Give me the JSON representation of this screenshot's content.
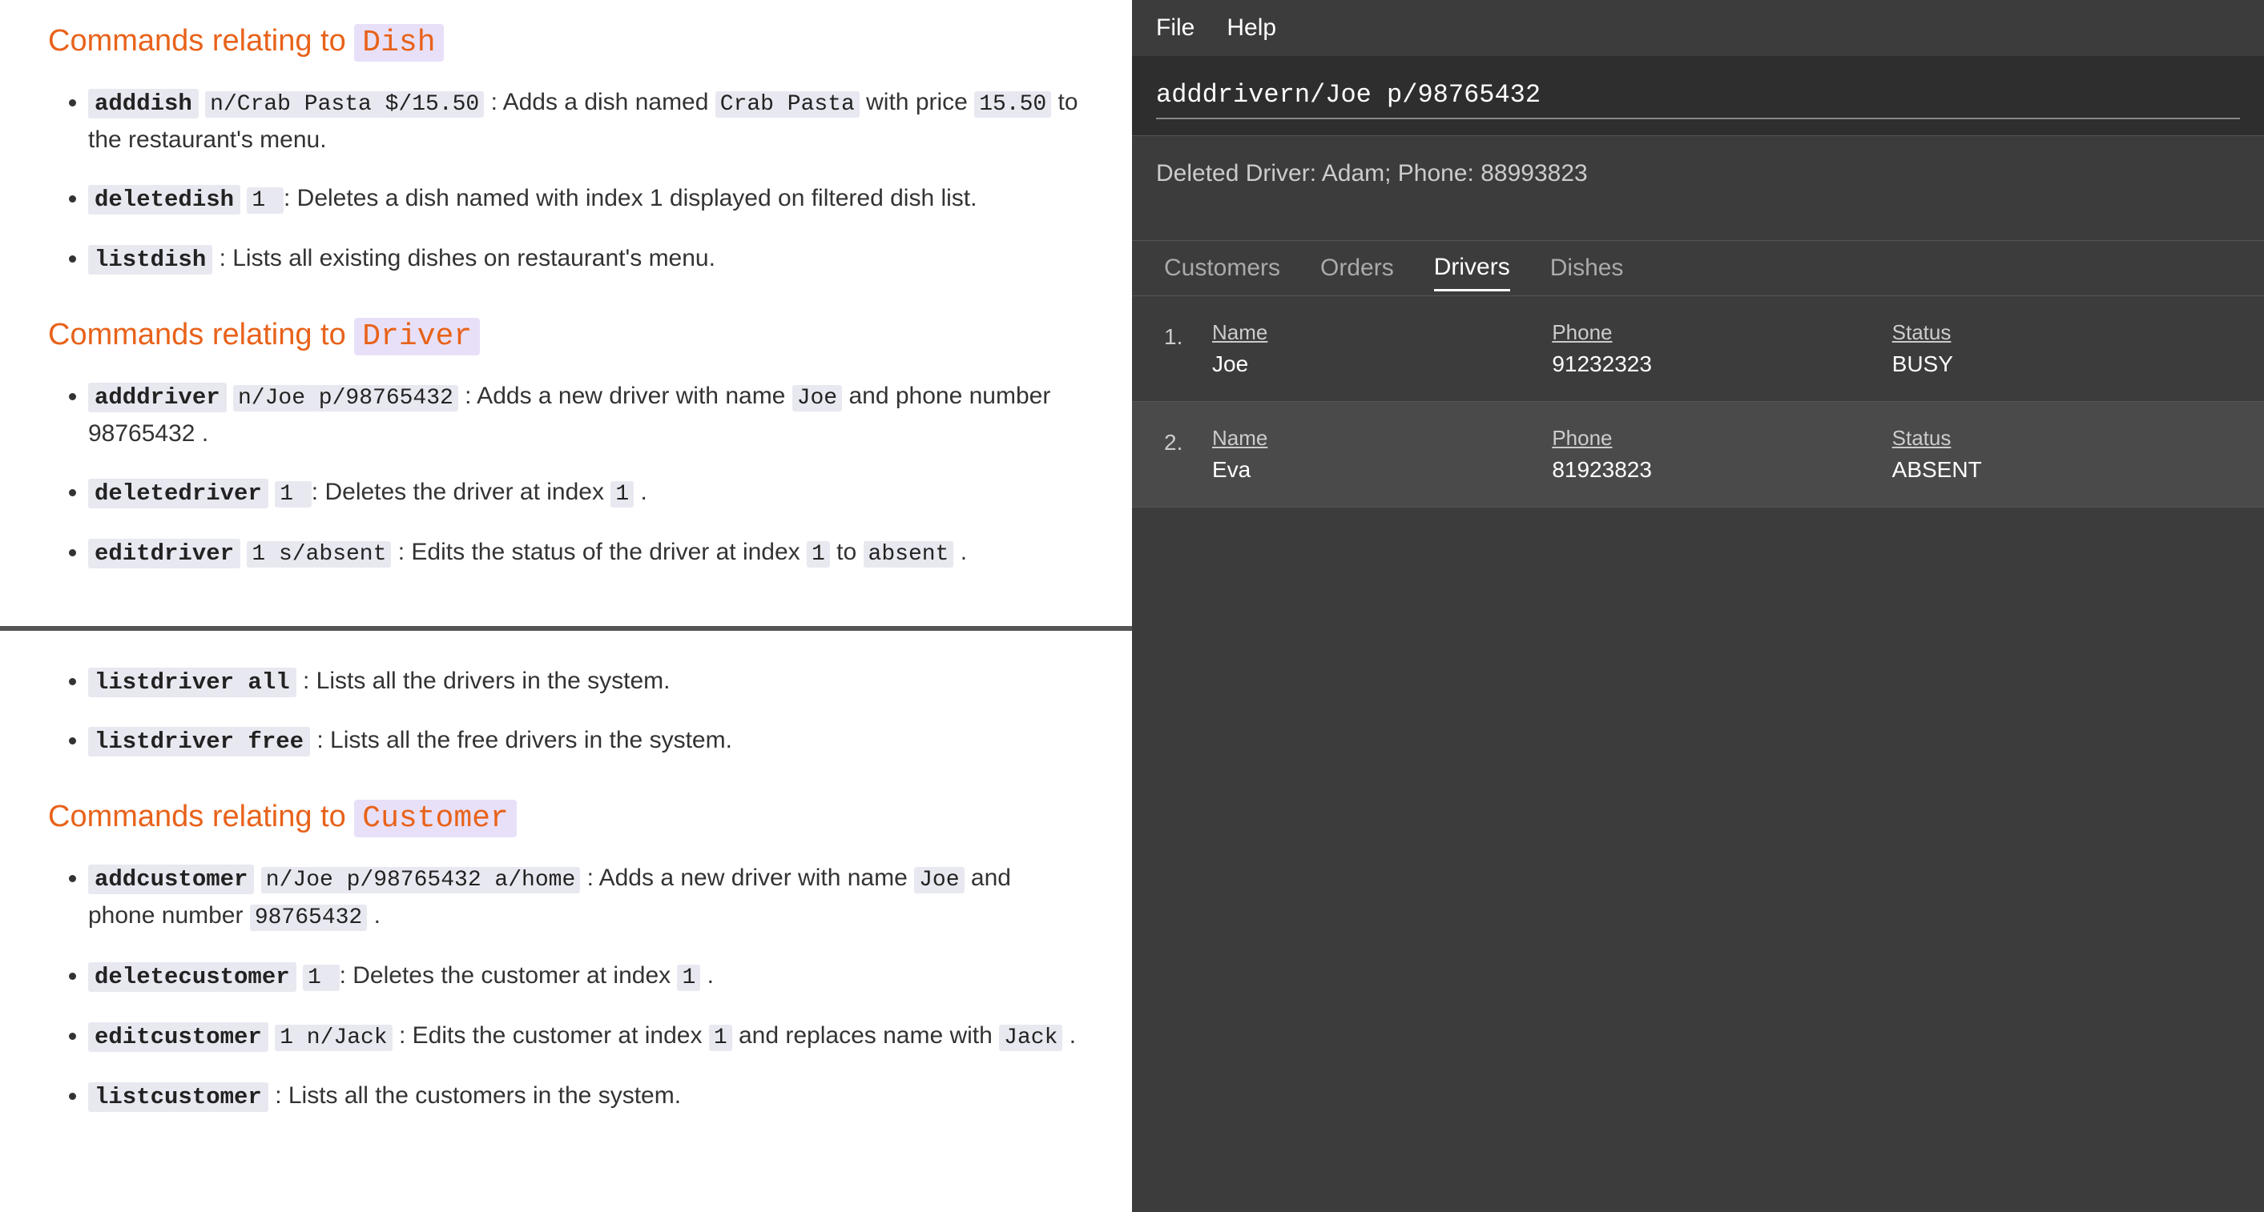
{
  "left": {
    "top_section": {
      "heading_prefix": "Commands relating to ",
      "heading_keyword": "Dish",
      "items": [
        {
          "cmd": "adddish",
          "cmd_args": "n/Crab Pasta $/15.50",
          "desc_before": ": Adds a dish named ",
          "inline1": "Crab Pasta",
          "desc_middle": " with price ",
          "inline2": "15.50",
          "desc_after": " to the restaurant's menu."
        },
        {
          "cmd": "deletedish",
          "cmd_args": null,
          "inline1": "1",
          "desc_after": ": Deletes a dish named with index 1 displayed on filtered dish list."
        },
        {
          "cmd": "listdish",
          "desc_after": ": Lists all existing dishes on restaurant's menu."
        }
      ]
    },
    "driver_section": {
      "heading_prefix": "Commands relating to ",
      "heading_keyword": "Driver",
      "items": [
        {
          "cmd": "adddriver",
          "cmd_args": "n/Joe p/98765432",
          "desc_before": ": Adds a new driver with name ",
          "inline1": "Joe",
          "desc_middle": " and phone number ",
          "inline2": "98765432",
          "desc_after": "."
        },
        {
          "cmd": "deletedriver",
          "inline1": "1",
          "desc_after": ": Deletes the driver at index ",
          "inline2": "1",
          "desc_end": "."
        },
        {
          "cmd": "editdriver",
          "cmd_args": "1 s/absent",
          "desc_before": ": Edits the status of the driver at index ",
          "inline1": "1",
          "desc_middle": " to ",
          "inline2": "absent",
          "desc_after": "."
        }
      ]
    },
    "bottom_section": {
      "driver_continued": [
        {
          "cmd": "listdriver all",
          "desc_after": ": Lists all the drivers in the system."
        },
        {
          "cmd": "listdriver free",
          "desc_after": ": Lists all the free drivers in the system."
        }
      ],
      "customer_section": {
        "heading_prefix": "Commands relating to ",
        "heading_keyword": "Customer",
        "items": [
          {
            "cmd": "addcustomer",
            "cmd_args": "n/Joe p/98765432 a/home",
            "desc_before": ": Adds a new driver with name ",
            "inline1": "Joe",
            "desc_middle": " and phone number ",
            "inline2": "98765432",
            "desc_after": "."
          },
          {
            "cmd": "deletecustomer",
            "inline1": "1",
            "desc_before": ": Deletes the customer at index ",
            "inline2": "1",
            "desc_after": "."
          },
          {
            "cmd": "editcustomer",
            "cmd_args": "1 n/Jack",
            "desc_before": ": Edits the customer at index ",
            "inline1": "1",
            "desc_middle": " and replaces name with ",
            "inline2": "Jack",
            "desc_after": "."
          },
          {
            "cmd": "listcustomer",
            "desc_after": ": Lists all the customers in the system."
          }
        ]
      }
    }
  },
  "right": {
    "menu": {
      "items": [
        "File",
        "Help"
      ]
    },
    "command_input": {
      "value": "adddrivern/Joe p/98765432",
      "placeholder": ""
    },
    "result": {
      "text": "Deleted Driver: Adam; Phone: 88993823"
    },
    "tabs": {
      "items": [
        "Customers",
        "Orders",
        "Drivers",
        "Dishes"
      ],
      "active": "Drivers"
    },
    "drivers_table": {
      "rows": [
        {
          "index": "1.",
          "name_header": "Name",
          "name_value": "Joe",
          "phone_header": "Phone",
          "phone_value": "91232323",
          "status_header": "Status",
          "status_value": "BUSY",
          "highlighted": false
        },
        {
          "index": "2.",
          "name_header": "Name",
          "name_value": "Eva",
          "phone_header": "Phone",
          "phone_value": "81923823",
          "status_header": "Status",
          "status_value": "ABSENT",
          "highlighted": true
        }
      ]
    }
  }
}
